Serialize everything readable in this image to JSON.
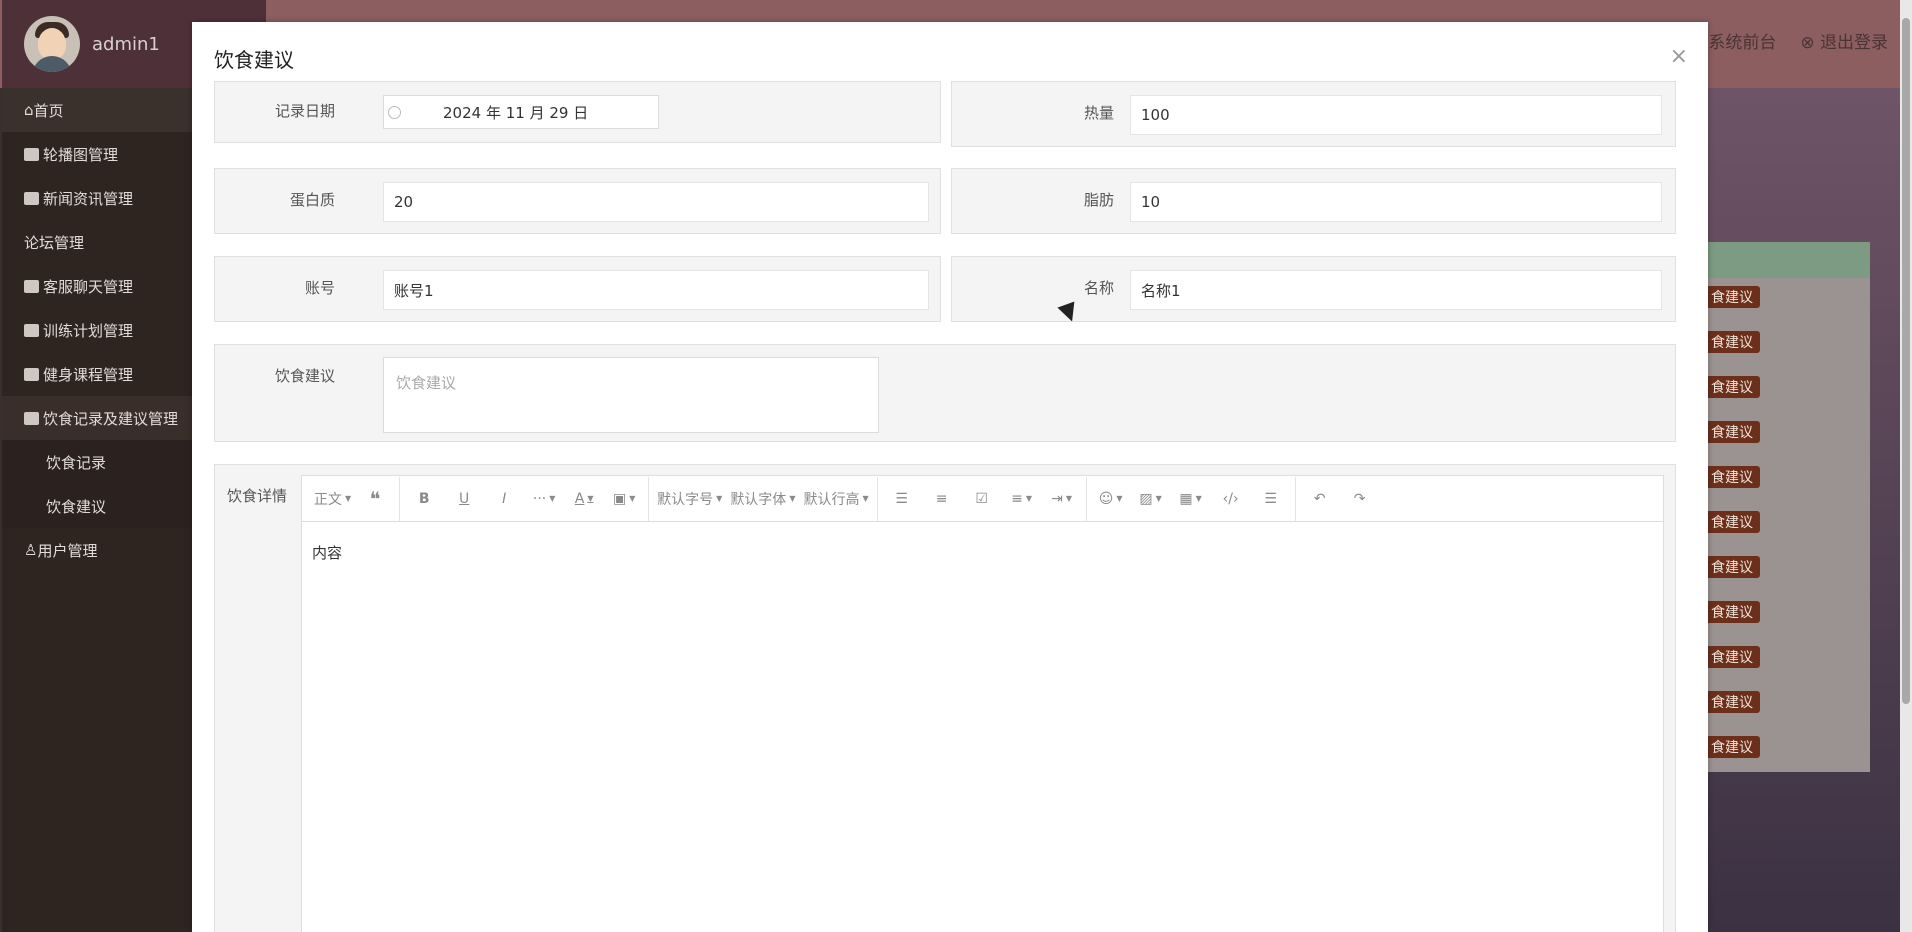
{
  "app": {
    "admin_name": "admin1",
    "top_links": [
      "系统前台",
      "退出登录"
    ],
    "sidebar": [
      {
        "label": "首页",
        "icon": "home-icon"
      },
      {
        "label": "轮播图管理",
        "icon": "table-icon"
      },
      {
        "label": "新闻资讯管理",
        "icon": "book-icon"
      },
      {
        "label": "论坛管理",
        "icon": ""
      },
      {
        "label": "客服聊天管理",
        "icon": "table-icon"
      },
      {
        "label": "训练计划管理",
        "icon": "table-icon"
      },
      {
        "label": "健身课程管理",
        "icon": "table-icon"
      },
      {
        "label": "饮食记录及建议管理",
        "icon": "book-icon"
      },
      {
        "label": "饮食记录",
        "icon": ""
      },
      {
        "label": "饮食建议",
        "icon": ""
      },
      {
        "label": "用户管理",
        "icon": "user-icon"
      }
    ],
    "row_button_label": "食建议",
    "row_count": 11
  },
  "modal": {
    "title": "饮食建议",
    "close": "×",
    "fields": {
      "record_date": {
        "label": "记录日期",
        "value": "2024 年 11 月 29 日"
      },
      "calories": {
        "label": "热量",
        "value": "100"
      },
      "protein": {
        "label": "蛋白质",
        "value": "20"
      },
      "fat": {
        "label": "脂肪",
        "value": "10"
      },
      "account": {
        "label": "账号",
        "value": "账号1"
      },
      "name": {
        "label": "名称",
        "value": "名称1"
      },
      "advice": {
        "label": "饮食建议",
        "placeholder": "饮食建议"
      },
      "details": {
        "label": "饮食详情"
      }
    },
    "editor": {
      "content": "内容",
      "toolbar": {
        "paragraph": "正文",
        "font_size": "默认字号",
        "font_family": "默认字体",
        "line_height": "默认行高"
      }
    }
  }
}
